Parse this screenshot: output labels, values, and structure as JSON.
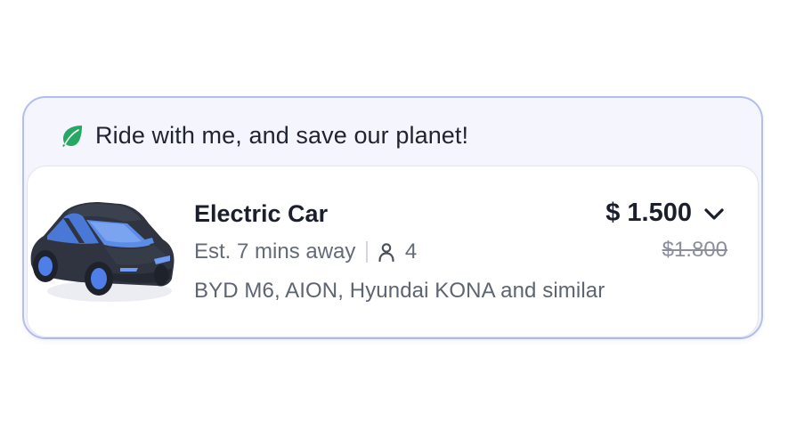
{
  "banner": {
    "icon": "leaf-icon",
    "text": "Ride with me, and save our planet!",
    "icon_color": "#27a862"
  },
  "ride_option": {
    "image": "electric-car",
    "name": "Electric Car",
    "eta": "Est. 7 mins away",
    "capacity": "4",
    "models": "BYD M6, AION, Hyundai KONA and similar",
    "price": "$ 1.500",
    "original_price": "$1.800"
  },
  "colors": {
    "card_border": "#b4bdf0",
    "card_background": "#f5f6fd",
    "car_body": "#2f3440",
    "car_accent": "#4f7ee8"
  }
}
